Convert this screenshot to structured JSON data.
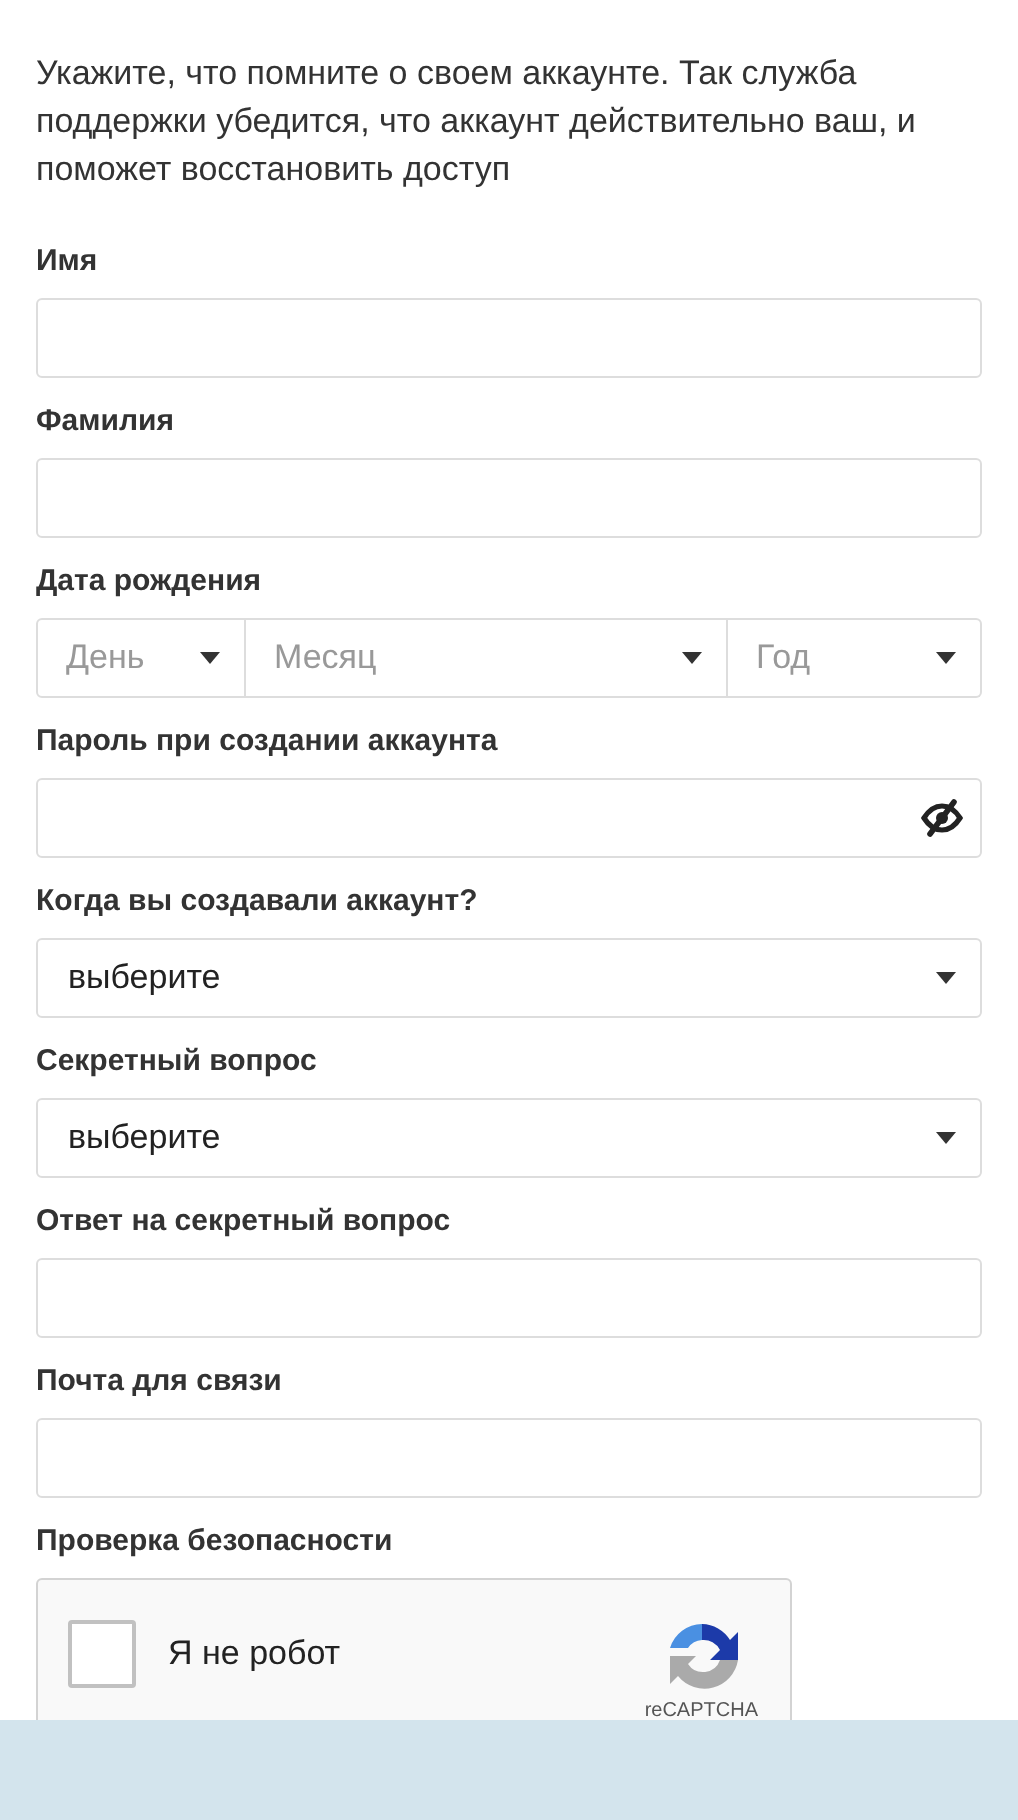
{
  "intro": "Укажите, что помните о своем аккаунте. Так служба поддержки убедится, что аккаунт действительно ваш, и поможет восстановить доступ",
  "fields": [
    {
      "kind": "text",
      "label": "Имя"
    },
    {
      "kind": "text",
      "label": "Фамилия"
    },
    {
      "kind": "date",
      "label": "Дата рождения",
      "parts": [
        {
          "placeholder": "День"
        },
        {
          "placeholder": "Месяц"
        },
        {
          "placeholder": "Год"
        }
      ]
    },
    {
      "kind": "password",
      "label": "Пароль при создании аккаунта"
    },
    {
      "kind": "select",
      "label": "Когда вы создавали аккаунт?",
      "value": "выберите"
    },
    {
      "kind": "select",
      "label": "Секретный вопрос",
      "value": "выберите"
    },
    {
      "kind": "text",
      "label": "Ответ на секретный вопрос"
    },
    {
      "kind": "text",
      "label": "Почта для связи"
    },
    {
      "kind": "captcha",
      "label": "Проверка безопасности",
      "checkbox_label": "Я не робот",
      "checked": false,
      "brand": "reCAPTCHA"
    }
  ]
}
